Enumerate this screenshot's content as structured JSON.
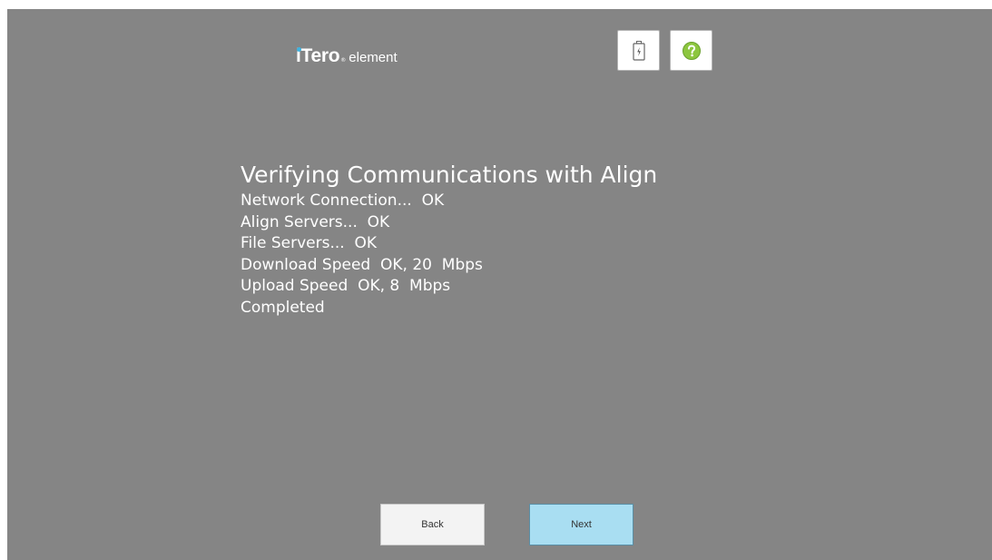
{
  "app": {
    "logo_mark": "iTero",
    "logo_reg": "®",
    "logo_sub": "element"
  },
  "toolbar": {
    "battery_icon": "battery-charging-icon",
    "help_icon": "help-icon",
    "help_color": "#8dc63f"
  },
  "main": {
    "title": "Verifying Communications with Align",
    "status_lines": [
      "Network Connection...  OK",
      "Align Servers...  OK",
      "File Servers...  OK",
      "Download Speed  OK, 20  Mbps",
      "Upload Speed  OK, 8  Mbps",
      "Completed"
    ]
  },
  "footer": {
    "back_label": "Back",
    "next_label": "Next"
  },
  "colors": {
    "background": "#858585",
    "next_button": "#a9def2",
    "logo_accent": "#3fb3e0"
  }
}
